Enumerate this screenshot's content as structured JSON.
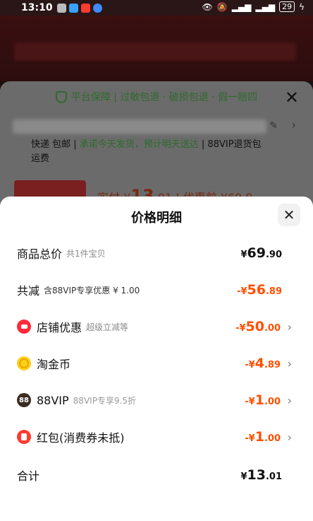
{
  "status_bar": {
    "time": "13:10",
    "battery": "29"
  },
  "background_sheet": {
    "guarantee": "平台保障 | 过敏包退 · 破损包退 · 假一赔四",
    "shipping_line1_a": "快递 包邮 | ",
    "shipping_line1_b": "承诺今天发货，预计明天送达",
    "shipping_line1_c": " | 88VIP退货包",
    "shipping_line2": "运费",
    "price_prefix": "实付 ¥",
    "price_big": "13",
    "price_small": ".01",
    "price_suffix": " | 优惠前 ¥69.9"
  },
  "price_detail": {
    "title": "价格明细",
    "rows": [
      {
        "label": "商品总价",
        "sub": "共1件宝贝",
        "amount_prefix": "¥",
        "amount_big": "69",
        "amount_small": ".90"
      },
      {
        "label": "共减",
        "sub": "含88VIP专享优惠 ¥ 1.00",
        "amount_prefix": "-¥",
        "amount_big": "56",
        "amount_small": ".89"
      },
      {
        "label": "店铺优惠",
        "sub": "超级立减等",
        "amount_prefix": "-¥",
        "amount_big": "50",
        "amount_small": ".00"
      },
      {
        "label": "淘金币",
        "sub": "",
        "amount_prefix": "-¥",
        "amount_big": "4",
        "amount_small": ".89"
      },
      {
        "label": "88VIP",
        "sub": "88VIP专享9.5折",
        "amount_prefix": "-¥",
        "amount_big": "1",
        "amount_small": ".00"
      },
      {
        "label": "红包(消费券未抵)",
        "sub": "",
        "amount_prefix": "-¥",
        "amount_big": "1",
        "amount_small": ".00"
      },
      {
        "label": "合计",
        "sub": "",
        "amount_prefix": "¥",
        "amount_big": "13",
        "amount_small": ".01"
      }
    ],
    "vip_badge": "88"
  },
  "colors": {
    "accent": "#ff5000",
    "guarantee_green": "#2f6a2f"
  }
}
